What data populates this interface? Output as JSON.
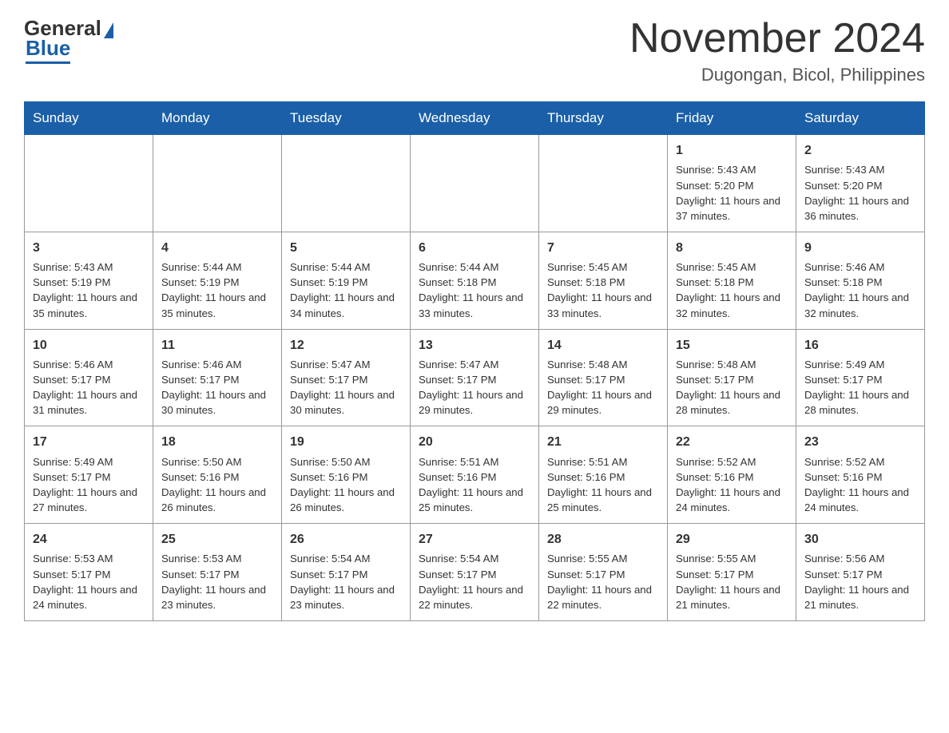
{
  "header": {
    "logo_general": "General",
    "logo_blue": "Blue",
    "month_title": "November 2024",
    "location": "Dugongan, Bicol, Philippines"
  },
  "weekdays": [
    "Sunday",
    "Monday",
    "Tuesday",
    "Wednesday",
    "Thursday",
    "Friday",
    "Saturday"
  ],
  "weeks": [
    [
      {
        "day": "",
        "info": ""
      },
      {
        "day": "",
        "info": ""
      },
      {
        "day": "",
        "info": ""
      },
      {
        "day": "",
        "info": ""
      },
      {
        "day": "",
        "info": ""
      },
      {
        "day": "1",
        "info": "Sunrise: 5:43 AM\nSunset: 5:20 PM\nDaylight: 11 hours and 37 minutes."
      },
      {
        "day": "2",
        "info": "Sunrise: 5:43 AM\nSunset: 5:20 PM\nDaylight: 11 hours and 36 minutes."
      }
    ],
    [
      {
        "day": "3",
        "info": "Sunrise: 5:43 AM\nSunset: 5:19 PM\nDaylight: 11 hours and 35 minutes."
      },
      {
        "day": "4",
        "info": "Sunrise: 5:44 AM\nSunset: 5:19 PM\nDaylight: 11 hours and 35 minutes."
      },
      {
        "day": "5",
        "info": "Sunrise: 5:44 AM\nSunset: 5:19 PM\nDaylight: 11 hours and 34 minutes."
      },
      {
        "day": "6",
        "info": "Sunrise: 5:44 AM\nSunset: 5:18 PM\nDaylight: 11 hours and 33 minutes."
      },
      {
        "day": "7",
        "info": "Sunrise: 5:45 AM\nSunset: 5:18 PM\nDaylight: 11 hours and 33 minutes."
      },
      {
        "day": "8",
        "info": "Sunrise: 5:45 AM\nSunset: 5:18 PM\nDaylight: 11 hours and 32 minutes."
      },
      {
        "day": "9",
        "info": "Sunrise: 5:46 AM\nSunset: 5:18 PM\nDaylight: 11 hours and 32 minutes."
      }
    ],
    [
      {
        "day": "10",
        "info": "Sunrise: 5:46 AM\nSunset: 5:17 PM\nDaylight: 11 hours and 31 minutes."
      },
      {
        "day": "11",
        "info": "Sunrise: 5:46 AM\nSunset: 5:17 PM\nDaylight: 11 hours and 30 minutes."
      },
      {
        "day": "12",
        "info": "Sunrise: 5:47 AM\nSunset: 5:17 PM\nDaylight: 11 hours and 30 minutes."
      },
      {
        "day": "13",
        "info": "Sunrise: 5:47 AM\nSunset: 5:17 PM\nDaylight: 11 hours and 29 minutes."
      },
      {
        "day": "14",
        "info": "Sunrise: 5:48 AM\nSunset: 5:17 PM\nDaylight: 11 hours and 29 minutes."
      },
      {
        "day": "15",
        "info": "Sunrise: 5:48 AM\nSunset: 5:17 PM\nDaylight: 11 hours and 28 minutes."
      },
      {
        "day": "16",
        "info": "Sunrise: 5:49 AM\nSunset: 5:17 PM\nDaylight: 11 hours and 28 minutes."
      }
    ],
    [
      {
        "day": "17",
        "info": "Sunrise: 5:49 AM\nSunset: 5:17 PM\nDaylight: 11 hours and 27 minutes."
      },
      {
        "day": "18",
        "info": "Sunrise: 5:50 AM\nSunset: 5:16 PM\nDaylight: 11 hours and 26 minutes."
      },
      {
        "day": "19",
        "info": "Sunrise: 5:50 AM\nSunset: 5:16 PM\nDaylight: 11 hours and 26 minutes."
      },
      {
        "day": "20",
        "info": "Sunrise: 5:51 AM\nSunset: 5:16 PM\nDaylight: 11 hours and 25 minutes."
      },
      {
        "day": "21",
        "info": "Sunrise: 5:51 AM\nSunset: 5:16 PM\nDaylight: 11 hours and 25 minutes."
      },
      {
        "day": "22",
        "info": "Sunrise: 5:52 AM\nSunset: 5:16 PM\nDaylight: 11 hours and 24 minutes."
      },
      {
        "day": "23",
        "info": "Sunrise: 5:52 AM\nSunset: 5:16 PM\nDaylight: 11 hours and 24 minutes."
      }
    ],
    [
      {
        "day": "24",
        "info": "Sunrise: 5:53 AM\nSunset: 5:17 PM\nDaylight: 11 hours and 24 minutes."
      },
      {
        "day": "25",
        "info": "Sunrise: 5:53 AM\nSunset: 5:17 PM\nDaylight: 11 hours and 23 minutes."
      },
      {
        "day": "26",
        "info": "Sunrise: 5:54 AM\nSunset: 5:17 PM\nDaylight: 11 hours and 23 minutes."
      },
      {
        "day": "27",
        "info": "Sunrise: 5:54 AM\nSunset: 5:17 PM\nDaylight: 11 hours and 22 minutes."
      },
      {
        "day": "28",
        "info": "Sunrise: 5:55 AM\nSunset: 5:17 PM\nDaylight: 11 hours and 22 minutes."
      },
      {
        "day": "29",
        "info": "Sunrise: 5:55 AM\nSunset: 5:17 PM\nDaylight: 11 hours and 21 minutes."
      },
      {
        "day": "30",
        "info": "Sunrise: 5:56 AM\nSunset: 5:17 PM\nDaylight: 11 hours and 21 minutes."
      }
    ]
  ]
}
